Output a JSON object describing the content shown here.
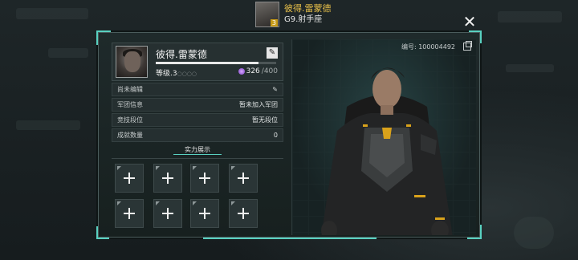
{
  "header": {
    "player_name": "彼得.雷蒙德",
    "player_sub": "G9.射手座",
    "avatar_level": "3"
  },
  "close_icon": "close-icon",
  "profile": {
    "name": "彼得.雷蒙德",
    "level_text": "等级.3",
    "level_dots": "○○○○",
    "xp_fraction": 0.85,
    "energy_current": "326",
    "energy_max": "/400",
    "id_label": "编号: 100004492"
  },
  "rows": [
    {
      "label": "尚未编辑",
      "value": ""
    },
    {
      "label": "军团信息",
      "value": "暂未加入军团"
    },
    {
      "label": "竞技段位",
      "value": "暂无段位"
    },
    {
      "label": "成就数量",
      "value": "0"
    }
  ],
  "power_tab_label": "实力展示",
  "slots": 8,
  "colors": {
    "accent": "#59d1c1",
    "name_gold": "#e8c04a"
  }
}
